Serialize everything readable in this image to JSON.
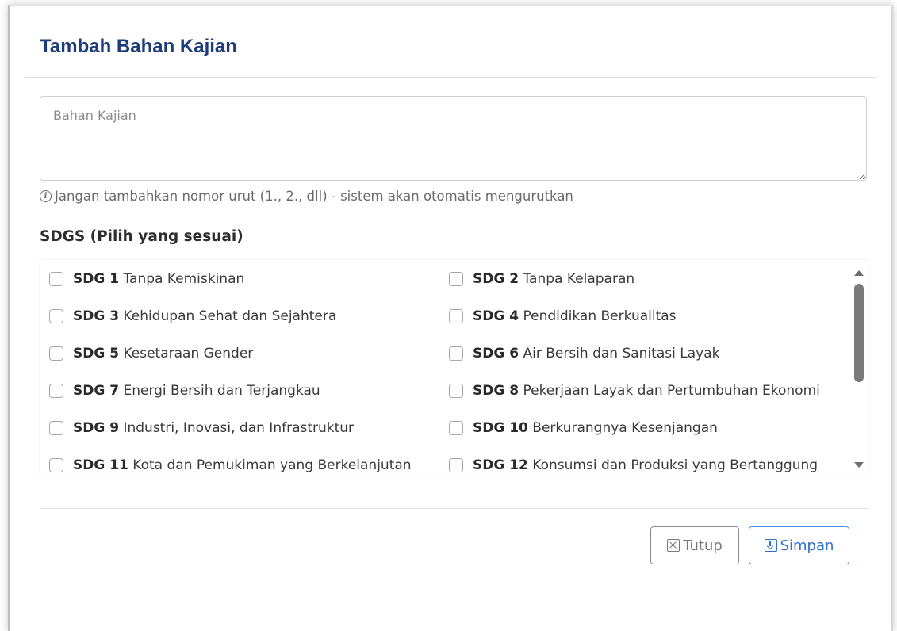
{
  "modal": {
    "title": "Tambah Bahan Kajian"
  },
  "form": {
    "textarea_placeholder": "Bahan Kajian",
    "textarea_value": "",
    "hint": "Jangan tambahkan nomor urut (1., 2., dll) - sistem akan otomatis mengurutkan",
    "sdgs_label": "SDGS (Pilih yang sesuai)"
  },
  "sdgs": [
    {
      "code": "SDG 1",
      "name": "Tanpa Kemiskinan",
      "checked": false
    },
    {
      "code": "SDG 2",
      "name": "Tanpa Kelaparan",
      "checked": false
    },
    {
      "code": "SDG 3",
      "name": "Kehidupan Sehat dan Sejahtera",
      "checked": false
    },
    {
      "code": "SDG 4",
      "name": "Pendidikan Berkualitas",
      "checked": false
    },
    {
      "code": "SDG 5",
      "name": "Kesetaraan Gender",
      "checked": false
    },
    {
      "code": "SDG 6",
      "name": "Air Bersih dan Sanitasi Layak",
      "checked": false
    },
    {
      "code": "SDG 7",
      "name": "Energi Bersih dan Terjangkau",
      "checked": false
    },
    {
      "code": "SDG 8",
      "name": "Pekerjaan Layak dan Pertumbuhan Ekonomi",
      "checked": false
    },
    {
      "code": "SDG 9",
      "name": "Industri, Inovasi, dan Infrastruktur",
      "checked": false
    },
    {
      "code": "SDG 10",
      "name": "Berkurangnya Kesenjangan",
      "checked": false
    },
    {
      "code": "SDG 11",
      "name": "Kota dan Pemukiman yang Berkelanjutan",
      "checked": false
    },
    {
      "code": "SDG 12",
      "name": "Konsumsi dan Produksi yang Bertanggung",
      "checked": false
    }
  ],
  "buttons": {
    "close_label": "Tutup",
    "save_label": "Simpan"
  },
  "icons": {
    "info": "info-circle-icon",
    "close": "close-box-icon",
    "save": "save-download-icon"
  },
  "colors": {
    "title": "#1c3d7a",
    "save_accent": "#2e6fd2",
    "close_text": "#7a7a7a"
  }
}
